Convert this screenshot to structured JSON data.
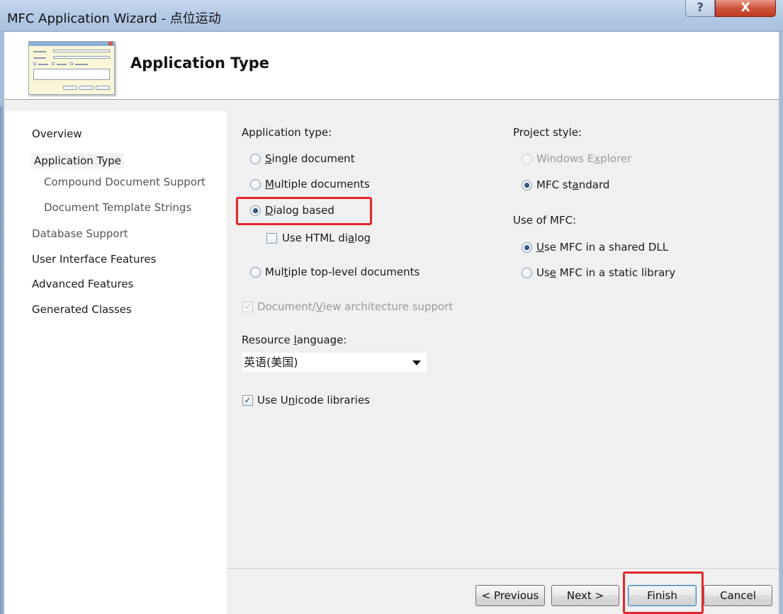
{
  "window": {
    "title": "MFC Application Wizard - 点位运动",
    "help_glyph": "?",
    "close_glyph": "X"
  },
  "header": {
    "title": "Application Type"
  },
  "nav": {
    "items": [
      {
        "label": "Overview"
      },
      {
        "label": "Application Type"
      },
      {
        "label": "Compound Document Support"
      },
      {
        "label": "Document Template Strings"
      },
      {
        "label": "Database Support"
      },
      {
        "label": "User Interface Features"
      },
      {
        "label": "Advanced Features"
      },
      {
        "label": "Generated Classes"
      }
    ]
  },
  "app_type": {
    "label": "Application type:",
    "options": {
      "single": {
        "pre": "",
        "key": "S",
        "post": "ingle document",
        "selected": false
      },
      "multiple": {
        "pre": "",
        "key": "M",
        "post": "ultiple documents",
        "selected": false
      },
      "dialog": {
        "pre": "",
        "key": "D",
        "post": "ialog based",
        "selected": true
      },
      "toplevel": {
        "pre": "Mul",
        "key": "t",
        "post": "iple top-level documents",
        "selected": false
      }
    },
    "html_dialog": {
      "pre": "Use HTML di",
      "key": "a",
      "post": "log",
      "checked": false
    },
    "docview": {
      "pre": "Document/",
      "key": "V",
      "post": "iew architecture support",
      "checked": true,
      "check_glyph": "✓"
    }
  },
  "resource_language": {
    "pre": "Resource ",
    "key": "l",
    "post": "anguage:",
    "value": "英语(美国)"
  },
  "unicode": {
    "pre": "Use U",
    "key": "n",
    "post": "icode libraries",
    "checked": true,
    "check_glyph": "✓"
  },
  "project_style": {
    "label": "Project style:",
    "explorer": {
      "pre": "Windows E",
      "key": "x",
      "post": "plorer",
      "selected": false
    },
    "mfc_standard": {
      "pre": "MFC st",
      "key": "a",
      "post": "ndard",
      "selected": true
    }
  },
  "use_of_mfc": {
    "label": "Use of MFC:",
    "shared": {
      "pre": "",
      "key": "U",
      "post": "se MFC in a shared DLL",
      "selected": true
    },
    "static": {
      "pre": "Us",
      "key": "e",
      "post": " MFC in a static library",
      "selected": false
    }
  },
  "buttons": {
    "previous": "< Previous",
    "next": "Next >",
    "finish": "Finish",
    "cancel": "Cancel"
  },
  "colors": {
    "highlight": "#e3262b",
    "titlebar": "#b5cbe6"
  }
}
